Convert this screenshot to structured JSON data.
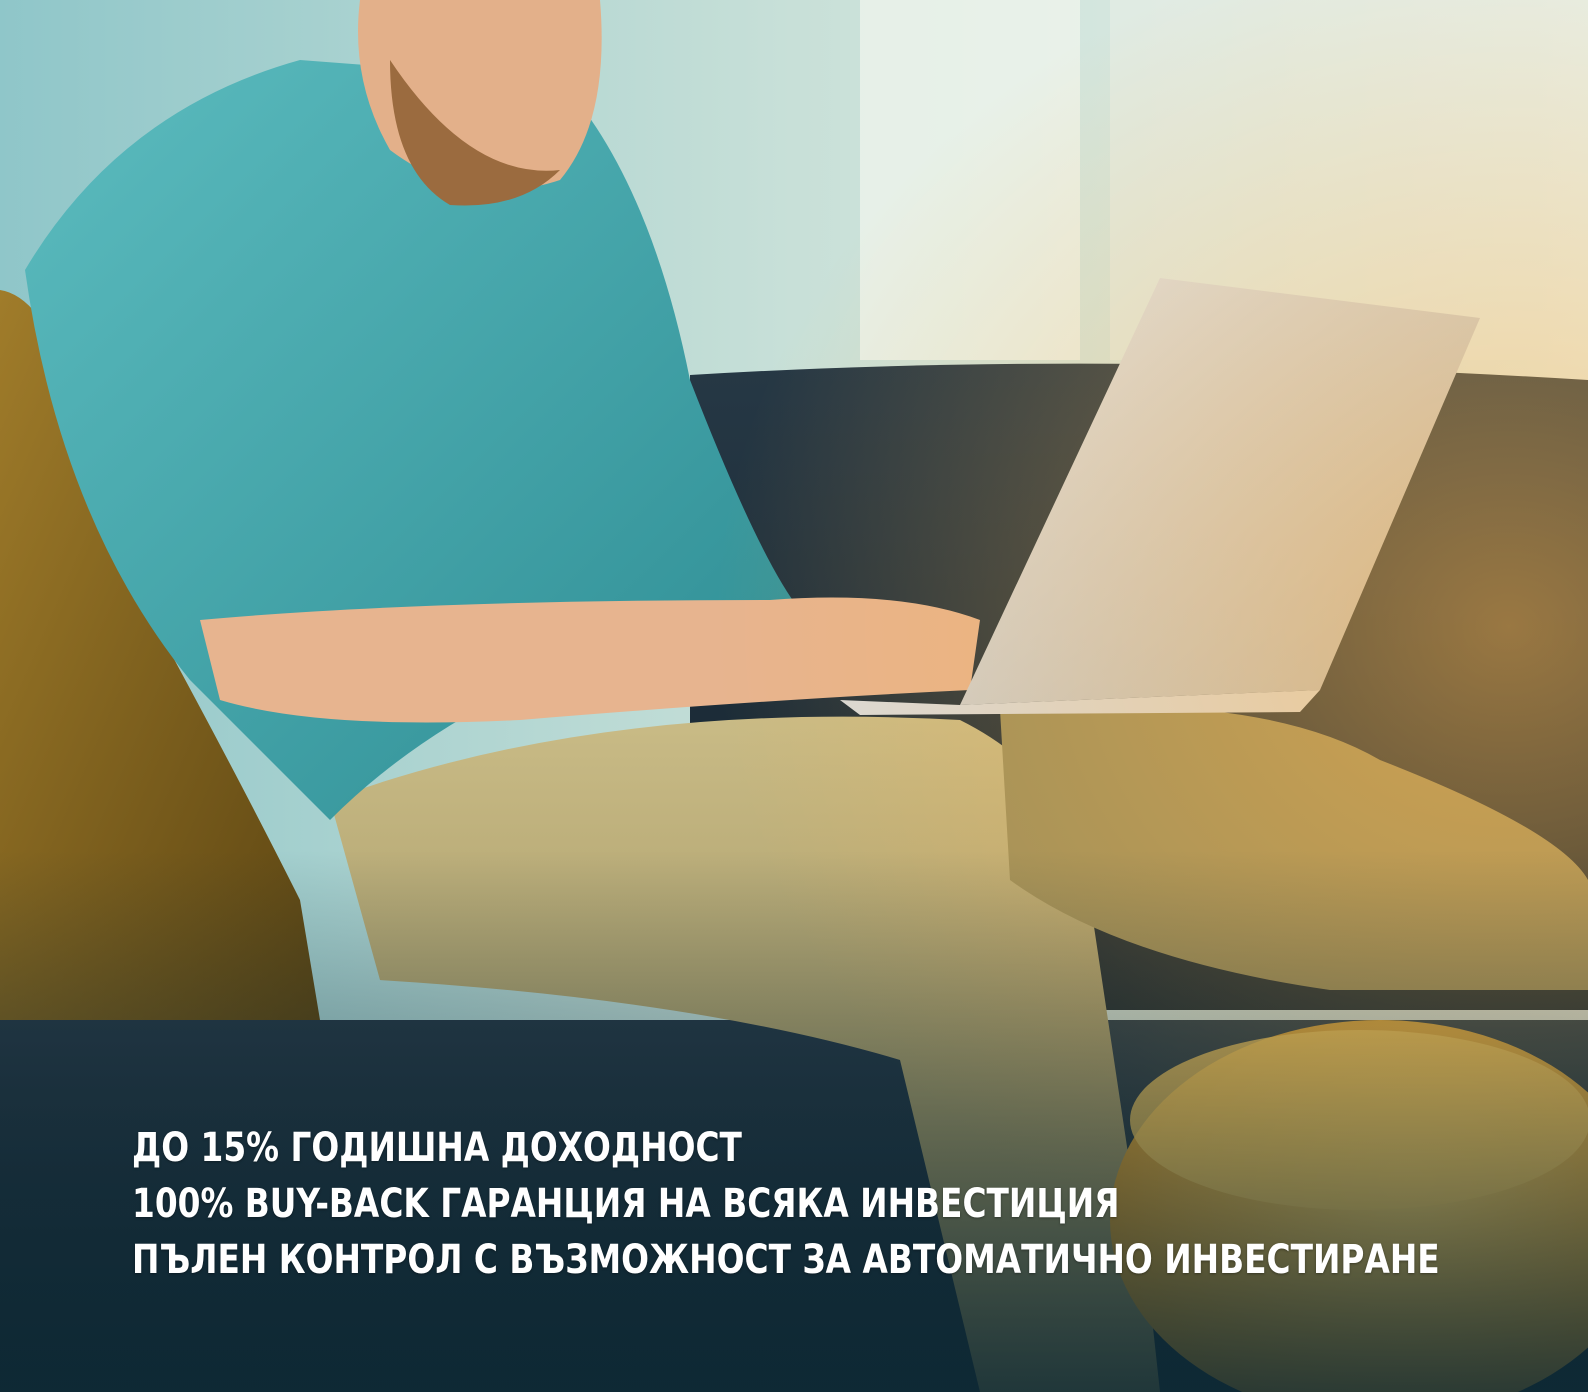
{
  "headline_lines": [
    "ДО 15% ГОДИШНА ДОХОДНОСТ",
    "100% BUY-BACK ГАРАНЦИЯ НА ВСЯКА ИНВЕСТИЦИЯ",
    "ПЪЛЕН КОНТРОЛ С ВЪЗМОЖНОСТ ЗА АВТОМАТИЧНО ИНВЕСТИРАНЕ"
  ],
  "colors": {
    "text": "#ffffff",
    "shirt": "#3fa3a6",
    "pants": "#b3a46c",
    "sofa": "#1c2e3c",
    "pillow": "#8a6a1e",
    "ottoman": "#e9a628",
    "laptop": "#cfd2d4"
  }
}
